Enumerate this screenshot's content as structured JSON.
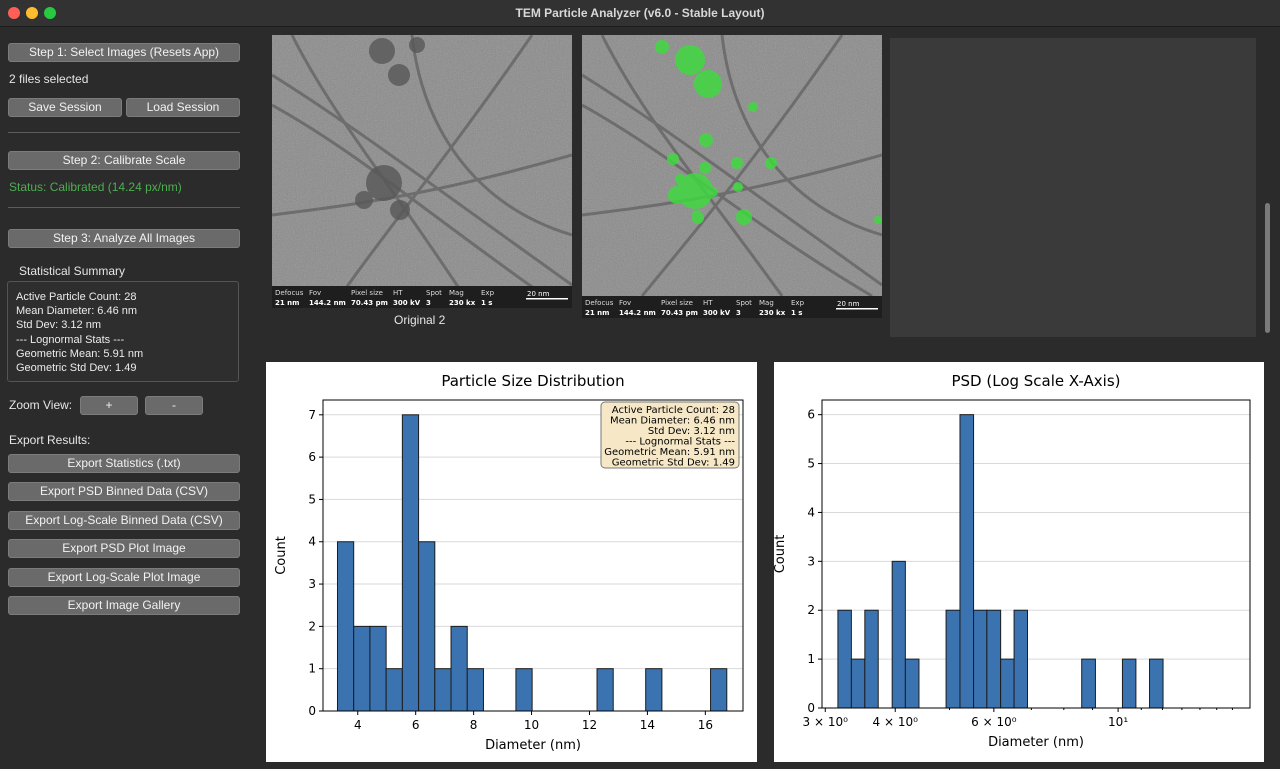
{
  "window": {
    "title": "TEM Particle Analyzer (v6.0 - Stable Layout)",
    "traffic_lights": [
      "#ff5f57",
      "#febc2e",
      "#28c840"
    ]
  },
  "sidebar": {
    "step1_label": "Step 1: Select Images (Resets App)",
    "files_selected": "2 files selected",
    "save_session": "Save Session",
    "load_session": "Load Session",
    "step2_label": "Step 2: Calibrate Scale",
    "status": "Status: Calibrated (14.24 px/nm)",
    "status_color": "#4caf50",
    "step3_label": "Step 3: Analyze All Images",
    "summary_title": "Statistical Summary",
    "summary_lines": [
      "Active Particle Count: 28",
      "Mean Diameter: 6.46 nm",
      "Std Dev: 3.12 nm",
      "--- Lognormal Stats ---",
      "Geometric Mean: 5.91 nm",
      "Geometric Std Dev: 1.49"
    ],
    "zoom_label": "Zoom View:",
    "zoom_in": "+",
    "zoom_out": "-",
    "export_title": "Export Results:",
    "export_buttons": [
      "Export Statistics (.txt)",
      "Export PSD Binned Data (CSV)",
      "Export Log-Scale Binned Data (CSV)",
      "Export PSD Plot Image",
      "Export Log-Scale Plot Image",
      "Export Image Gallery"
    ]
  },
  "gallery": {
    "original_caption": "Original 2",
    "info_headers": [
      "Defocus",
      "Fov",
      "Pixel size",
      "HT",
      "Spot",
      "Mag",
      "Exp"
    ],
    "info_values": [
      "21 nm",
      "144.2 nm",
      "70.43 pm",
      "300 kV",
      "3",
      "230 kx",
      "1 s"
    ],
    "scale_bar": "20 nm",
    "overlay_color": "#3ddc3d"
  },
  "chart_data": [
    {
      "type": "bar",
      "title": "Particle Size Distribution",
      "xlabel": "Diameter (nm)",
      "ylabel": "Count",
      "xlim": [
        2.8,
        17.3
      ],
      "ylim": [
        0,
        7.35
      ],
      "xticks": [
        4,
        6,
        8,
        10,
        12,
        14,
        16
      ],
      "yticks": [
        0,
        1,
        2,
        3,
        4,
        5,
        6,
        7
      ],
      "bin_width": 0.56,
      "bins": [
        {
          "x": 3.3,
          "count": 4
        },
        {
          "x": 3.86,
          "count": 2
        },
        {
          "x": 4.42,
          "count": 2
        },
        {
          "x": 4.98,
          "count": 1
        },
        {
          "x": 5.54,
          "count": 7
        },
        {
          "x": 6.1,
          "count": 4
        },
        {
          "x": 6.66,
          "count": 1
        },
        {
          "x": 7.22,
          "count": 2
        },
        {
          "x": 7.78,
          "count": 1
        },
        {
          "x": 9.46,
          "count": 1
        },
        {
          "x": 12.26,
          "count": 1
        },
        {
          "x": 13.94,
          "count": 1
        },
        {
          "x": 16.18,
          "count": 1
        }
      ],
      "bar_color": "#3b73b0",
      "legend_box": [
        "Active Particle Count: 28",
        "Mean Diameter: 6.46 nm",
        "Std Dev: 3.12 nm",
        "--- Lognormal Stats ---",
        "Geometric Mean: 5.91 nm",
        "Geometric Std Dev: 1.49"
      ],
      "legend_placement": "top-right",
      "grid": "y"
    },
    {
      "type": "bar",
      "scale_x": "log",
      "title": "PSD (Log Scale X-Axis)",
      "xlabel": "Diameter (nm)",
      "ylabel": "Count",
      "xlim": [
        2.96,
        17.2
      ],
      "ylim": [
        0,
        6.3
      ],
      "xticks": [
        3,
        4,
        6,
        10
      ],
      "xtick_labels": [
        "3 × 10⁰",
        "4 × 10⁰",
        "6 × 10⁰",
        "10¹"
      ],
      "yticks": [
        0,
        1,
        2,
        3,
        4,
        5,
        6
      ],
      "bin_edges": [
        3.16,
        3.34,
        3.53,
        3.73,
        3.95,
        4.17,
        4.41,
        4.67,
        4.93,
        5.22,
        5.52,
        5.83,
        6.17,
        6.52,
        6.89,
        7.29,
        7.7,
        8.15,
        8.61,
        9.11,
        9.63,
        10.18,
        10.76,
        11.38,
        12.03,
        12.72,
        13.45,
        14.22
      ],
      "counts": [
        2,
        1,
        2,
        0,
        3,
        1,
        0,
        0,
        2,
        6,
        2,
        2,
        1,
        2,
        0,
        0,
        0,
        0,
        1,
        0,
        0,
        1,
        0,
        1
      ],
      "bar_color": "#3b73b0",
      "grid": "y"
    }
  ]
}
